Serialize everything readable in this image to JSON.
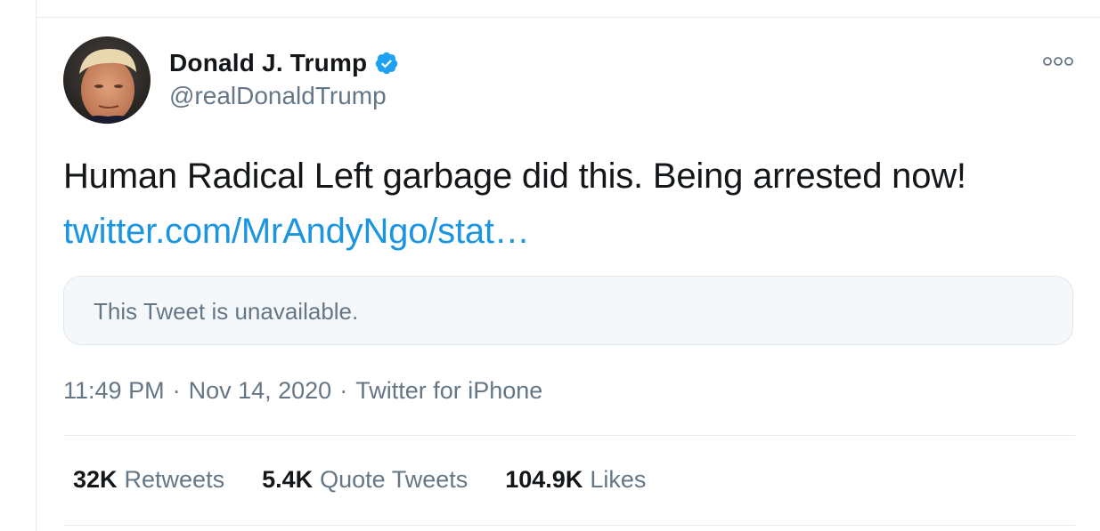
{
  "tweet": {
    "author": {
      "name": "Donald J. Trump",
      "handle": "@realDonaldTrump",
      "verified": true,
      "avatar_icon": "avatar-photo"
    },
    "text": "Human Radical Left garbage did this. Being arrested now!",
    "link_text": "twitter.com/MrAndyNgo/stat…",
    "quoted_tweet": {
      "text": "This Tweet is unavailable."
    },
    "meta": {
      "time": "11:49 PM",
      "separator": "·",
      "date": "Nov 14, 2020",
      "source": "Twitter for iPhone"
    },
    "stats": {
      "retweets": {
        "count": "32K",
        "label": "Retweets"
      },
      "quote_tweets": {
        "count": "5.4K",
        "label": "Quote Tweets"
      },
      "likes": {
        "count": "104.9K",
        "label": "Likes"
      }
    },
    "more_icon": "more-options-icon"
  },
  "colors": {
    "text_primary": "#14171a",
    "text_secondary": "#657786",
    "link": "#1b95e0",
    "verified": "#1da1f2",
    "divider": "#e6ecf0",
    "quote_bg": "#f5f8fa"
  }
}
